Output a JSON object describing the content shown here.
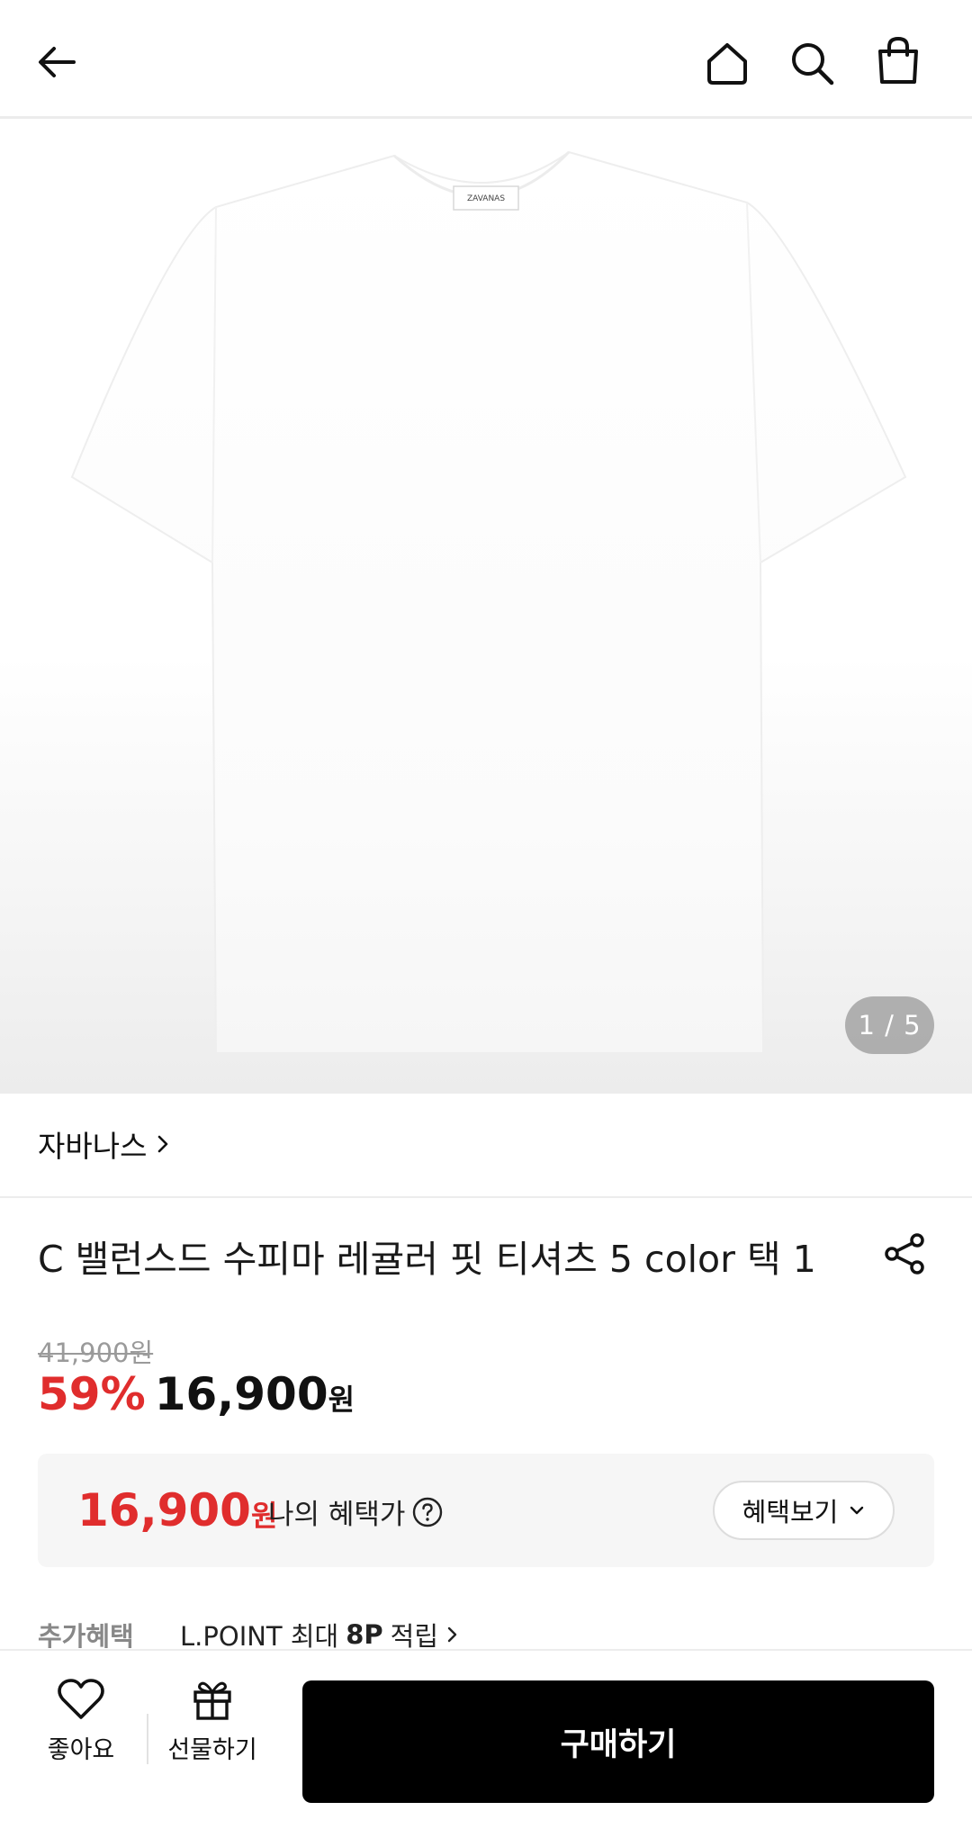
{
  "header": {
    "back_icon": "arrow-left-icon",
    "home_icon": "home-icon",
    "search_icon": "search-icon",
    "cart_icon": "shopping-bag-icon"
  },
  "gallery": {
    "label_brand_tag": "ZAVANAS",
    "counter": "1 / 5"
  },
  "product": {
    "brand": "자바나스",
    "title": "C 밸런스드 수피마 레귤러 핏 티셔츠 5 color 택 1",
    "original_price": "41,900원",
    "discount": "59%",
    "price": "16,900",
    "price_unit": "원"
  },
  "benefit": {
    "price": "16,900",
    "price_unit": "원",
    "label": "나의 혜택가",
    "button": "혜택보기"
  },
  "extra": {
    "label": "추가혜택",
    "prefix": "L.POINT 최대",
    "points": "8P",
    "suffix": "적립"
  },
  "bottom": {
    "like_label": "좋아요",
    "gift_label": "선물하기",
    "buy_label": "구매하기"
  },
  "colors": {
    "accent_red": "#e02d2d",
    "buy_button": "#000000"
  }
}
